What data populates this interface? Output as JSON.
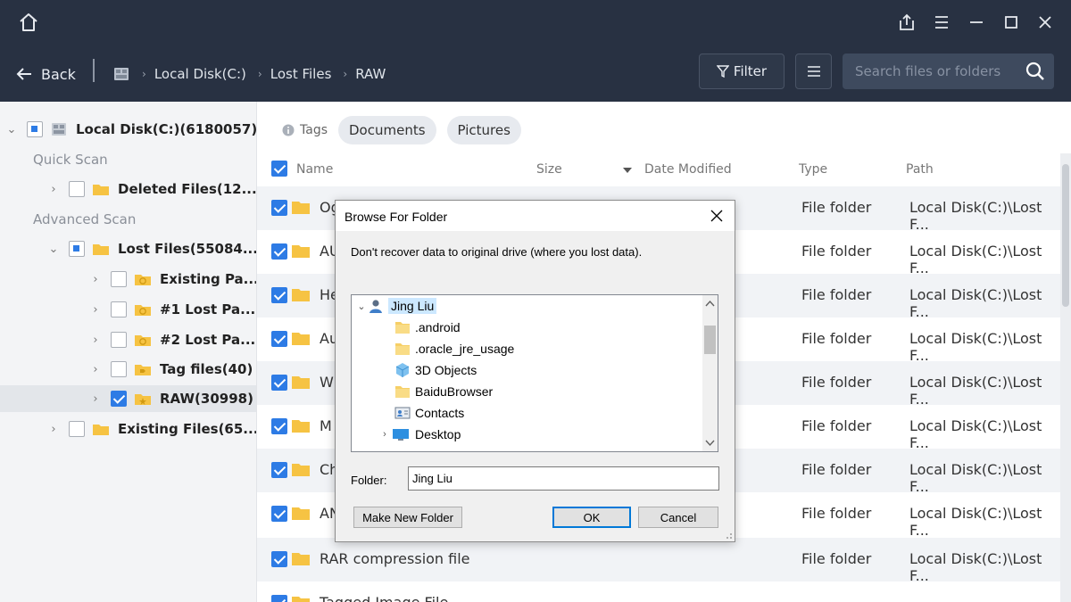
{
  "titlebar": {
    "icons": [
      "home-icon",
      "share-icon",
      "menu-icon",
      "minimize-icon",
      "maximize-icon",
      "close-icon"
    ]
  },
  "nav": {
    "back_label": "Back",
    "breadcrumb": [
      "Local Disk(C:)",
      "Lost Files",
      "RAW"
    ],
    "filter_label": "Filter",
    "search_placeholder": "Search files or folders"
  },
  "sidebar": {
    "root_label": "Local Disk(C:)(6180057)",
    "quick_scan_label": "Quick Scan",
    "advanced_scan_label": "Advanced Scan",
    "items": [
      {
        "label": "Deleted Files(12...",
        "check": "none"
      },
      {
        "label": "Lost Files(55084...",
        "check": "partial"
      },
      {
        "label": "Existing Pa...",
        "check": "none"
      },
      {
        "label": "#1 Lost Pa...",
        "check": "none"
      },
      {
        "label": "#2 Lost Pa...",
        "check": "none"
      },
      {
        "label": "Tag files(40)",
        "check": "none"
      },
      {
        "label": "RAW(30998)",
        "check": "checked"
      },
      {
        "label": "Existing Files(65...",
        "check": "none"
      }
    ]
  },
  "main": {
    "tags_label": "Tags",
    "tags": [
      "Documents",
      "Pictures"
    ],
    "columns": {
      "name": "Name",
      "size": "Size",
      "date": "Date Modified",
      "type": "Type",
      "path": "Path"
    },
    "rows": [
      {
        "name": "Og",
        "type": "File folder",
        "path": "Local Disk(C:)\\Lost F..."
      },
      {
        "name": "AU",
        "type": "File folder",
        "path": "Local Disk(C:)\\Lost F..."
      },
      {
        "name": "He",
        "type": "File folder",
        "path": "Local Disk(C:)\\Lost F..."
      },
      {
        "name": "Au",
        "type": "File folder",
        "path": "Local Disk(C:)\\Lost F..."
      },
      {
        "name": "W",
        "type": "File folder",
        "path": "Local Disk(C:)\\Lost F..."
      },
      {
        "name": "M",
        "type": "File folder",
        "path": "Local Disk(C:)\\Lost F..."
      },
      {
        "name": "Ch",
        "type": "File folder",
        "path": "Local Disk(C:)\\Lost F..."
      },
      {
        "name": "AN",
        "type": "File folder",
        "path": "Local Disk(C:)\\Lost F..."
      },
      {
        "name": "RAR compression file",
        "type": "File folder",
        "path": "Local Disk(C:)\\Lost F..."
      },
      {
        "name": "Tagged Image File",
        "type": "",
        "path": ""
      }
    ]
  },
  "dialog": {
    "title": "Browse For Folder",
    "message": "Don't recover data to original drive (where you lost data).",
    "tree": [
      {
        "label": "Jing Liu",
        "icon": "user-icon",
        "selected": true
      },
      {
        "label": ".android",
        "icon": "folder-icon"
      },
      {
        "label": ".oracle_jre_usage",
        "icon": "folder-icon"
      },
      {
        "label": "3D Objects",
        "icon": "3d-objects-icon"
      },
      {
        "label": "BaiduBrowser",
        "icon": "folder-icon"
      },
      {
        "label": "Contacts",
        "icon": "contacts-icon"
      },
      {
        "label": "Desktop",
        "icon": "desktop-icon"
      }
    ],
    "folder_label": "Folder:",
    "folder_value": "Jing Liu",
    "make_new_folder": "Make New Folder",
    "ok": "OK",
    "cancel": "Cancel"
  },
  "colors": {
    "header_bg": "#283142",
    "accent_blue": "#2d7be5",
    "folder_yellow": "#f6c343",
    "sidebar_bg": "#f3f4f6"
  }
}
